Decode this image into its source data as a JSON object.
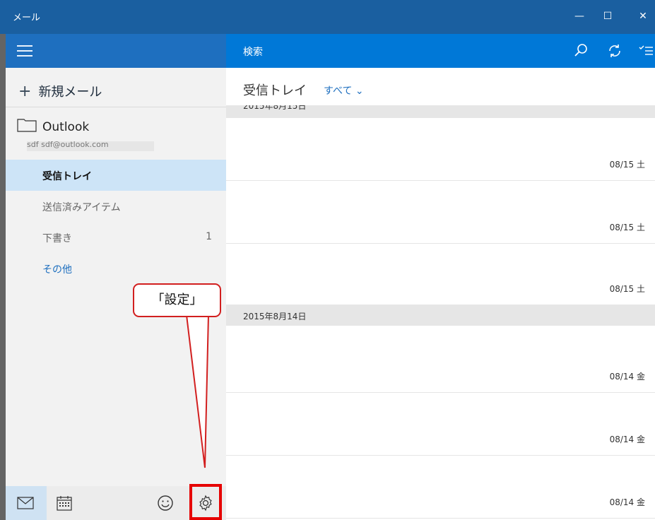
{
  "window": {
    "title": "メール",
    "minimize": "—",
    "maximize": "☐",
    "close": "✕"
  },
  "topbar": {
    "search_label": "検索",
    "icons": [
      "search-icon",
      "sync-icon",
      "select-icon"
    ]
  },
  "sidebar": {
    "new_mail": "新規メール",
    "account_name": "Outlook",
    "account_email": "sdf sdf@outlook.com",
    "folders": [
      {
        "label": "受信トレイ",
        "count": ""
      },
      {
        "label": "送信済みアイテム",
        "count": ""
      },
      {
        "label": "下書き",
        "count": "1"
      },
      {
        "label": "その他",
        "count": ""
      }
    ]
  },
  "bottombar": {
    "icons": [
      "mail-icon",
      "calendar-icon",
      "feedback-smiley-icon",
      "settings-gear-icon"
    ]
  },
  "callout": {
    "text": "「設定」"
  },
  "main": {
    "title": "受信トレイ",
    "filter": "すべて ⌄",
    "groups": [
      {
        "date": "2015年8月15日",
        "messages": [
          {
            "date": "08/15 土"
          },
          {
            "date": "08/15 土"
          },
          {
            "date": "08/15 土"
          }
        ]
      },
      {
        "date": "2015年8月14日",
        "messages": [
          {
            "date": "08/14 金"
          },
          {
            "date": "08/14 金"
          },
          {
            "date": "08/14 金"
          }
        ]
      }
    ]
  },
  "colors": {
    "titlebar": "#1a5fa0",
    "accent": "#0078d7",
    "sidebar_bg": "#f2f2f2",
    "selected": "#cde4f7",
    "callout_red": "#e60000"
  }
}
